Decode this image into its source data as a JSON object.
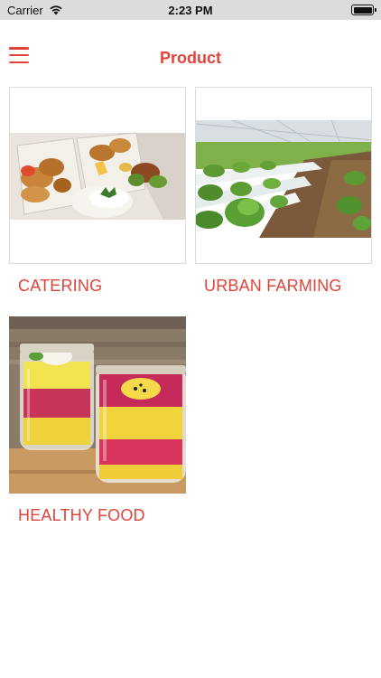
{
  "status_bar": {
    "carrier": "Carrier",
    "time": "2:23 PM"
  },
  "nav": {
    "title": "Product",
    "menu_icon": "hamburger-menu-icon"
  },
  "products": [
    {
      "label": "CATERING",
      "image": "catering-box-photo"
    },
    {
      "label": "URBAN FARMING",
      "image": "greenhouse-hydroponics-photo"
    },
    {
      "label": "HEALTHY FOOD",
      "image": "smoothie-jars-photo"
    }
  ],
  "colors": {
    "accent": "#e0443a",
    "status_bar_bg": "#dcdcdc",
    "card_border": "#dcdcdc"
  }
}
